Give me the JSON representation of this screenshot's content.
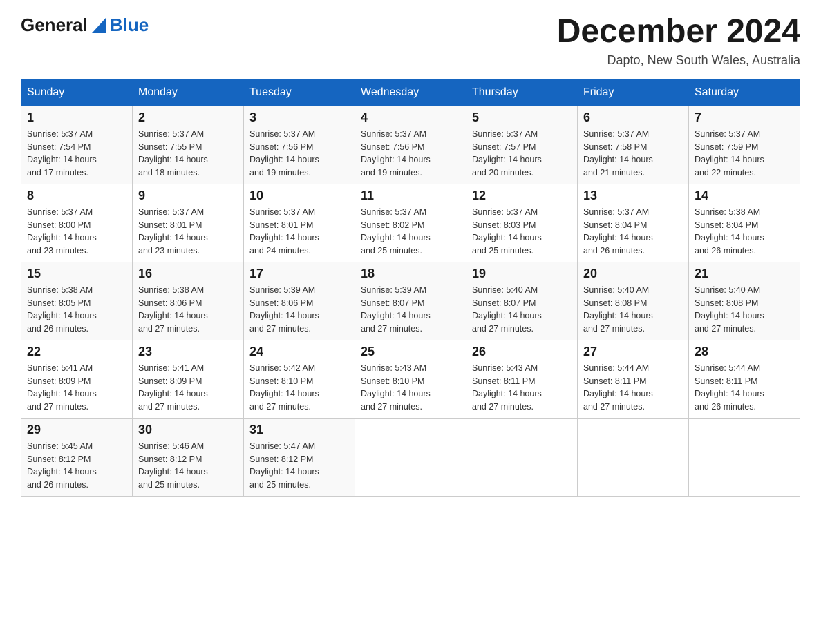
{
  "logo": {
    "text_general": "General",
    "text_blue": "Blue"
  },
  "title": "December 2024",
  "subtitle": "Dapto, New South Wales, Australia",
  "days_of_week": [
    "Sunday",
    "Monday",
    "Tuesday",
    "Wednesday",
    "Thursday",
    "Friday",
    "Saturday"
  ],
  "weeks": [
    [
      {
        "day": "1",
        "sunrise": "5:37 AM",
        "sunset": "7:54 PM",
        "daylight": "14 hours and 17 minutes."
      },
      {
        "day": "2",
        "sunrise": "5:37 AM",
        "sunset": "7:55 PM",
        "daylight": "14 hours and 18 minutes."
      },
      {
        "day": "3",
        "sunrise": "5:37 AM",
        "sunset": "7:56 PM",
        "daylight": "14 hours and 19 minutes."
      },
      {
        "day": "4",
        "sunrise": "5:37 AM",
        "sunset": "7:56 PM",
        "daylight": "14 hours and 19 minutes."
      },
      {
        "day": "5",
        "sunrise": "5:37 AM",
        "sunset": "7:57 PM",
        "daylight": "14 hours and 20 minutes."
      },
      {
        "day": "6",
        "sunrise": "5:37 AM",
        "sunset": "7:58 PM",
        "daylight": "14 hours and 21 minutes."
      },
      {
        "day": "7",
        "sunrise": "5:37 AM",
        "sunset": "7:59 PM",
        "daylight": "14 hours and 22 minutes."
      }
    ],
    [
      {
        "day": "8",
        "sunrise": "5:37 AM",
        "sunset": "8:00 PM",
        "daylight": "14 hours and 23 minutes."
      },
      {
        "day": "9",
        "sunrise": "5:37 AM",
        "sunset": "8:01 PM",
        "daylight": "14 hours and 23 minutes."
      },
      {
        "day": "10",
        "sunrise": "5:37 AM",
        "sunset": "8:01 PM",
        "daylight": "14 hours and 24 minutes."
      },
      {
        "day": "11",
        "sunrise": "5:37 AM",
        "sunset": "8:02 PM",
        "daylight": "14 hours and 25 minutes."
      },
      {
        "day": "12",
        "sunrise": "5:37 AM",
        "sunset": "8:03 PM",
        "daylight": "14 hours and 25 minutes."
      },
      {
        "day": "13",
        "sunrise": "5:37 AM",
        "sunset": "8:04 PM",
        "daylight": "14 hours and 26 minutes."
      },
      {
        "day": "14",
        "sunrise": "5:38 AM",
        "sunset": "8:04 PM",
        "daylight": "14 hours and 26 minutes."
      }
    ],
    [
      {
        "day": "15",
        "sunrise": "5:38 AM",
        "sunset": "8:05 PM",
        "daylight": "14 hours and 26 minutes."
      },
      {
        "day": "16",
        "sunrise": "5:38 AM",
        "sunset": "8:06 PM",
        "daylight": "14 hours and 27 minutes."
      },
      {
        "day": "17",
        "sunrise": "5:39 AM",
        "sunset": "8:06 PM",
        "daylight": "14 hours and 27 minutes."
      },
      {
        "day": "18",
        "sunrise": "5:39 AM",
        "sunset": "8:07 PM",
        "daylight": "14 hours and 27 minutes."
      },
      {
        "day": "19",
        "sunrise": "5:40 AM",
        "sunset": "8:07 PM",
        "daylight": "14 hours and 27 minutes."
      },
      {
        "day": "20",
        "sunrise": "5:40 AM",
        "sunset": "8:08 PM",
        "daylight": "14 hours and 27 minutes."
      },
      {
        "day": "21",
        "sunrise": "5:40 AM",
        "sunset": "8:08 PM",
        "daylight": "14 hours and 27 minutes."
      }
    ],
    [
      {
        "day": "22",
        "sunrise": "5:41 AM",
        "sunset": "8:09 PM",
        "daylight": "14 hours and 27 minutes."
      },
      {
        "day": "23",
        "sunrise": "5:41 AM",
        "sunset": "8:09 PM",
        "daylight": "14 hours and 27 minutes."
      },
      {
        "day": "24",
        "sunrise": "5:42 AM",
        "sunset": "8:10 PM",
        "daylight": "14 hours and 27 minutes."
      },
      {
        "day": "25",
        "sunrise": "5:43 AM",
        "sunset": "8:10 PM",
        "daylight": "14 hours and 27 minutes."
      },
      {
        "day": "26",
        "sunrise": "5:43 AM",
        "sunset": "8:11 PM",
        "daylight": "14 hours and 27 minutes."
      },
      {
        "day": "27",
        "sunrise": "5:44 AM",
        "sunset": "8:11 PM",
        "daylight": "14 hours and 27 minutes."
      },
      {
        "day": "28",
        "sunrise": "5:44 AM",
        "sunset": "8:11 PM",
        "daylight": "14 hours and 26 minutes."
      }
    ],
    [
      {
        "day": "29",
        "sunrise": "5:45 AM",
        "sunset": "8:12 PM",
        "daylight": "14 hours and 26 minutes."
      },
      {
        "day": "30",
        "sunrise": "5:46 AM",
        "sunset": "8:12 PM",
        "daylight": "14 hours and 25 minutes."
      },
      {
        "day": "31",
        "sunrise": "5:47 AM",
        "sunset": "8:12 PM",
        "daylight": "14 hours and 25 minutes."
      },
      null,
      null,
      null,
      null
    ]
  ],
  "labels": {
    "sunrise": "Sunrise:",
    "sunset": "Sunset:",
    "daylight": "Daylight:"
  }
}
